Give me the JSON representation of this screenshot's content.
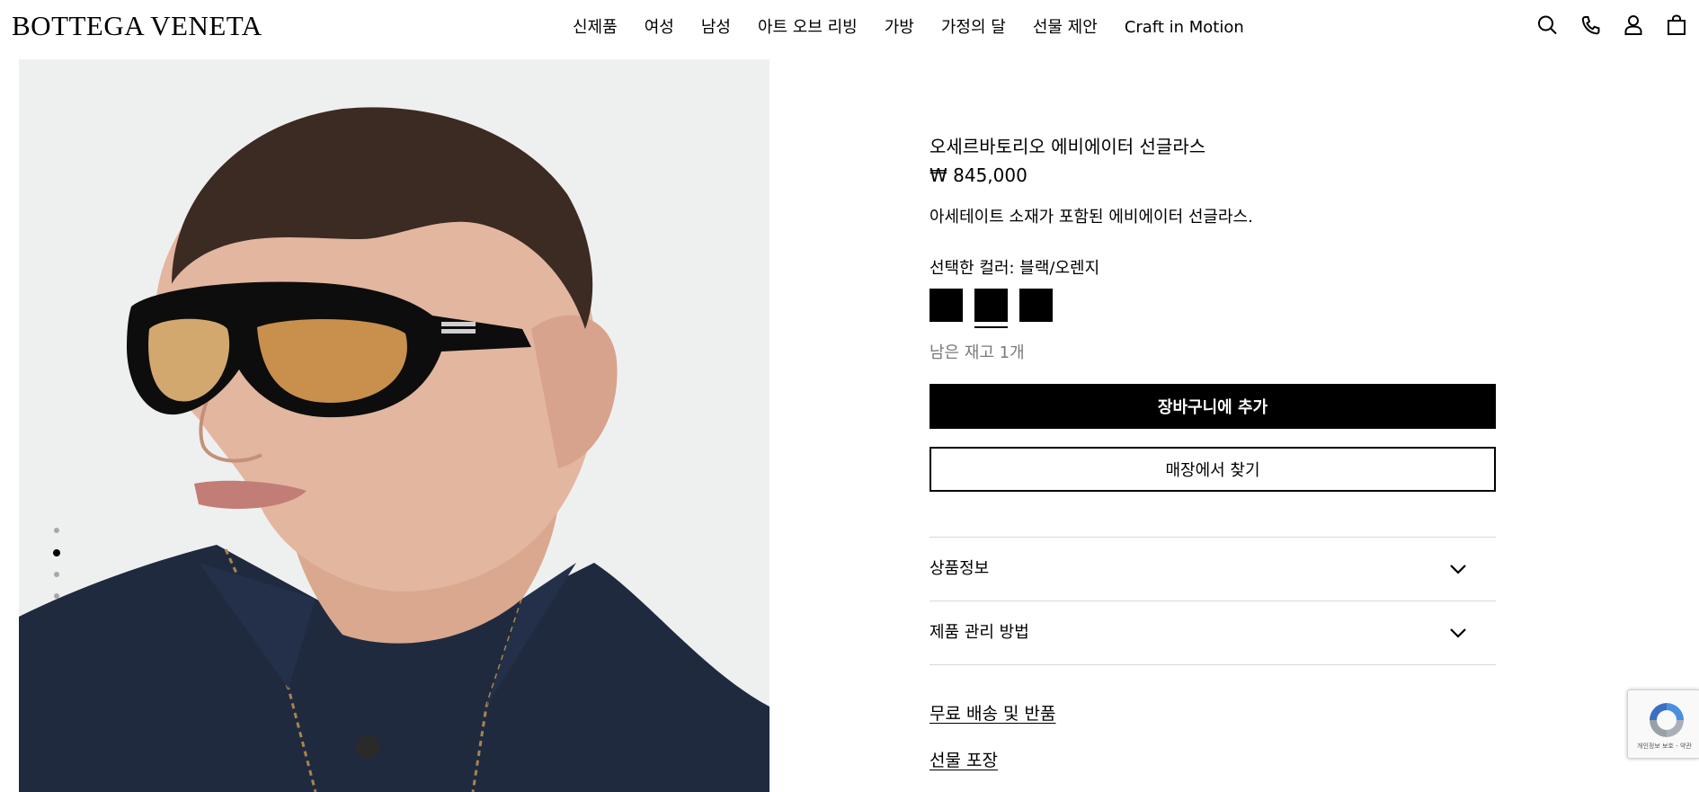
{
  "brand": {
    "logo_text": "BOTTEGA VENETA"
  },
  "nav": {
    "items": [
      {
        "label": "신제품"
      },
      {
        "label": "여성"
      },
      {
        "label": "남성"
      },
      {
        "label": "아트 오브 리빙"
      },
      {
        "label": "가방"
      },
      {
        "label": "가정의 달"
      },
      {
        "label": "선물 제안"
      },
      {
        "label": "Craft in Motion"
      }
    ]
  },
  "header_icons": [
    "search-icon",
    "phone-icon",
    "account-icon",
    "bag-icon"
  ],
  "gallery": {
    "total_images": 4,
    "active_index": 2
  },
  "product": {
    "title": "오세르바토리오 에비에이터 선글라스",
    "price": "₩ 845,000",
    "description": "아세테이트 소재가 포함된 에비에이터 선글라스.",
    "selected_color_label": "선택한 컬러: 블랙/오렌지",
    "swatches": [
      {
        "color": "#000000",
        "selected": false
      },
      {
        "color": "#000000",
        "selected": true
      },
      {
        "color": "#000000",
        "selected": false
      }
    ],
    "stock_text": "남은 재고 1개",
    "add_to_cart_label": "장바구니에 추가",
    "find_in_store_label": "매장에서 찾기"
  },
  "accordion": [
    {
      "label": "상품정보"
    },
    {
      "label": "제품 관리 방법"
    }
  ],
  "links": {
    "shipping": "무료 배송 및 반품",
    "gift_wrap": "선물 포장"
  },
  "recaptcha": {
    "text": "개인정보 보호 - 약관"
  },
  "colors": {
    "accent": "#000000",
    "image_bg": "#eef0ef",
    "stock_text": "#7a7a7a"
  }
}
